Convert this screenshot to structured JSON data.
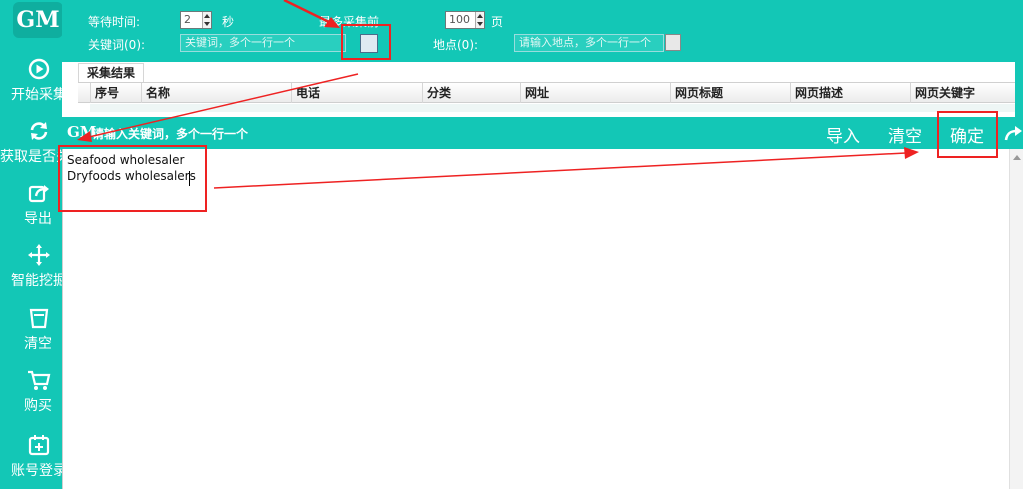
{
  "app": {
    "logo_text": "GM"
  },
  "sidebar": {
    "items": [
      {
        "label": "开始采集",
        "icon": "play-circle-icon"
      },
      {
        "label": "获取是否关",
        "icon": "refresh-icon"
      },
      {
        "label": "导出",
        "icon": "share-export-icon"
      },
      {
        "label": "智能挖掘",
        "icon": "move-crosshair-icon"
      },
      {
        "label": "清空",
        "icon": "trash-icon"
      },
      {
        "label": "购买",
        "icon": "cart-icon"
      },
      {
        "label": "账号登录",
        "icon": "calendar-plus-icon"
      }
    ]
  },
  "settings": {
    "wait_label": "等待时间:",
    "wait_value": "2",
    "wait_unit": "秒",
    "max_pages_label": "最多采集前",
    "max_pages_value": "100",
    "max_pages_unit": "页",
    "keywords_label": "关键词(0):",
    "keywords_placeholder": "关键词，多个一行一个",
    "location_label": "地点(0):",
    "location_placeholder": "请输入地点，多个一行一个"
  },
  "results": {
    "tab_label": "采集结果",
    "columns": [
      "序号",
      "名称",
      "电话",
      "分类",
      "网址",
      "网页标题",
      "网页描述",
      "网页关键字"
    ]
  },
  "dialog": {
    "logo_text": "GM",
    "title": "请输入关键词，多个一行一个",
    "import_label": "导入",
    "clear_label": "清空",
    "confirm_label": "确定",
    "keywords": [
      "Seafood wholesaler",
      "Dryfoods wholesalers"
    ]
  },
  "colors": {
    "accent": "#13c7b6",
    "annotation_red": "#ee2222"
  }
}
